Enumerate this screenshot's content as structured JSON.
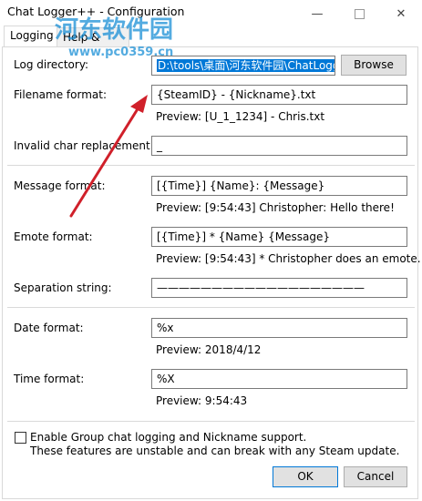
{
  "window": {
    "title": "Chat Logger++ - Configuration"
  },
  "tabs": [
    {
      "label": "Logging"
    },
    {
      "label": "Help & Formatting"
    }
  ],
  "watermark": {
    "name": "河东软件园",
    "url": "www.pc0359.cn"
  },
  "fields": {
    "log_directory": {
      "label": "Log directory:",
      "value": "D:\\tools\\桌面\\河东软件园\\ChatLogg",
      "browse": "Browse"
    },
    "filename_format": {
      "label": "Filename format:",
      "value": "{SteamID} - {Nickname}.txt",
      "preview": "Preview: [U_1_1234] - Chris.txt"
    },
    "invalid_char": {
      "label": "Invalid char replacement:",
      "value": "_"
    },
    "message_format": {
      "label": "Message format:",
      "value": "[{Time}] {Name}: {Message}",
      "preview": "Preview: [9:54:43] Christopher: Hello there!"
    },
    "emote_format": {
      "label": "Emote format:",
      "value": "[{Time}] * {Name} {Message}",
      "preview": "Preview: [9:54:43] * Christopher does an emote."
    },
    "separation_string": {
      "label": "Separation string:",
      "value": "———————————————————"
    },
    "date_format": {
      "label": "Date format:",
      "value": "%x",
      "preview": "Preview: 2018/4/12"
    },
    "time_format": {
      "label": "Time format:",
      "value": "%X",
      "preview": "Preview: 9:54:43"
    }
  },
  "group_chat": {
    "label": "Enable Group chat logging and Nickname support.",
    "note": "These features are unstable and can break with any Steam update.",
    "checked": false
  },
  "buttons": {
    "ok": "OK",
    "cancel": "Cancel"
  },
  "colors": {
    "arrow": "#d0202a",
    "selection": "#0078d7"
  }
}
